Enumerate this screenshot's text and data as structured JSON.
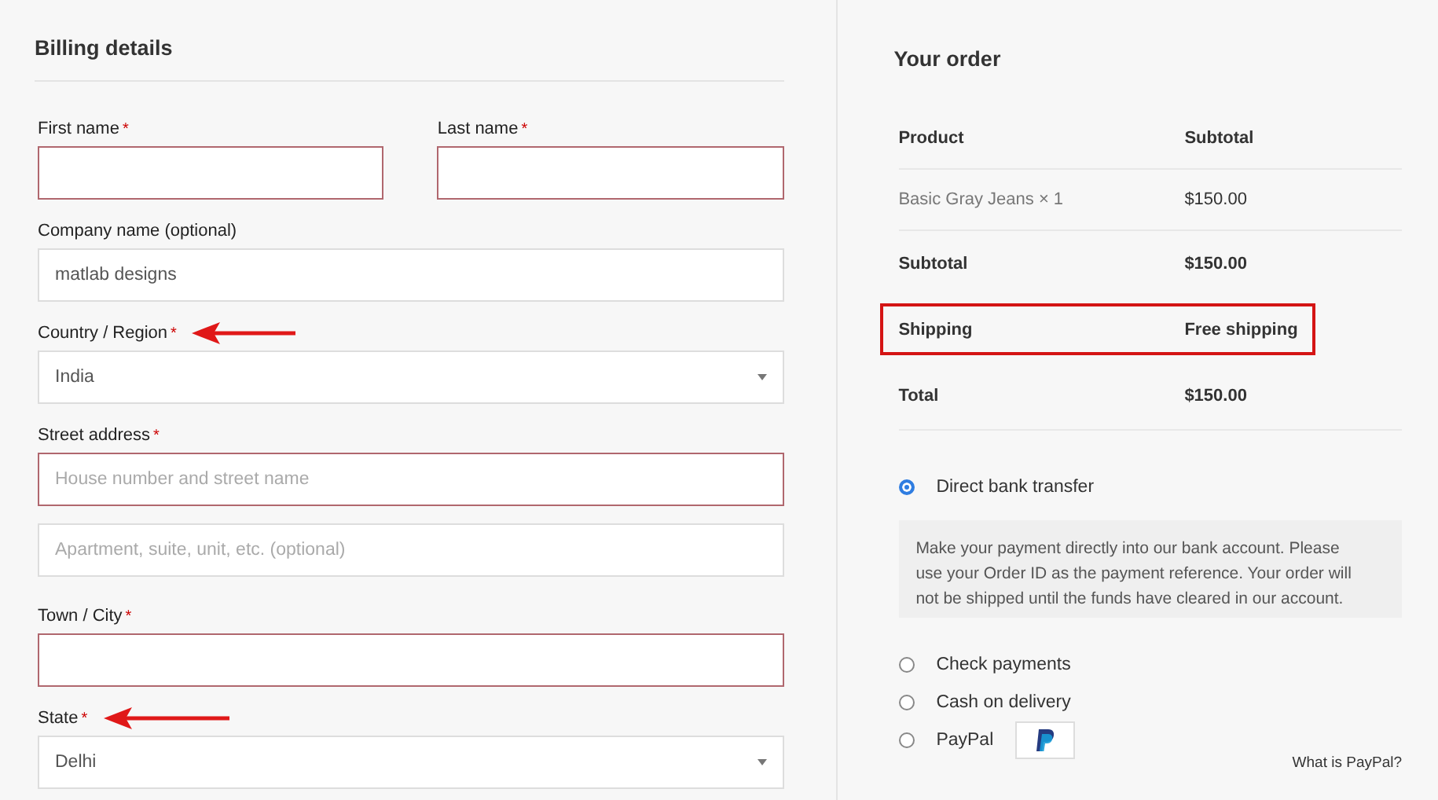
{
  "billing": {
    "title": "Billing details",
    "rows": [
      {
        "fields": [
          {
            "label": "First name",
            "required_mark": "*",
            "kind": "text",
            "invalid": true,
            "arrow": false
          },
          {
            "label": "Last name",
            "required_mark": "*",
            "kind": "text",
            "invalid": true,
            "arrow": false
          }
        ]
      },
      {
        "fields": [
          {
            "label": "Company name (optional)",
            "kind": "text",
            "value": "matlab designs",
            "invalid": false,
            "arrow": false
          }
        ]
      },
      {
        "fields": [
          {
            "label": "Country / Region",
            "required_mark": "*",
            "kind": "select",
            "value": "India",
            "invalid": false,
            "arrow": true
          }
        ]
      },
      {
        "fields": [
          {
            "label": "Street address",
            "required_mark": "*",
            "kind": "text",
            "placeholder": "House number and street name",
            "invalid": true,
            "arrow": false
          }
        ]
      },
      {
        "fields": [
          {
            "kind": "text",
            "placeholder": "Apartment, suite, unit, etc. (optional)",
            "invalid": false
          }
        ]
      },
      {
        "fields": [
          {
            "label": "Town / City",
            "required_mark": "*",
            "kind": "text",
            "invalid": true,
            "arrow": false
          }
        ]
      },
      {
        "fields": [
          {
            "label": "State",
            "required_mark": "*",
            "kind": "select",
            "value": "Delhi",
            "invalid": false,
            "arrow": true
          }
        ]
      }
    ]
  },
  "order": {
    "title": "Your order",
    "columns": [
      "Product",
      "Subtotal"
    ],
    "items": [
      {
        "product": "Basic Gray Jeans",
        "quantity": "× 1",
        "subtotal": "$150.00"
      }
    ],
    "totals": [
      {
        "label": "Subtotal",
        "value": "$150.00",
        "highlighted": false
      },
      {
        "label": "Shipping",
        "value": "Free shipping",
        "highlighted": true
      },
      {
        "label": "Total",
        "value": "$150.00",
        "highlighted": false
      }
    ],
    "payment_methods": [
      {
        "label": "Direct bank transfer",
        "selected": true,
        "description": "Make your payment directly into our bank account. Please use your Order ID as the payment reference. Your order will not be shipped until the funds have cleared in our account."
      },
      {
        "label": "Check payments",
        "selected": false
      },
      {
        "label": "Cash on delivery",
        "selected": false
      },
      {
        "label": "PayPal",
        "selected": false,
        "logo": true,
        "link": "What is PayPal?"
      }
    ]
  }
}
